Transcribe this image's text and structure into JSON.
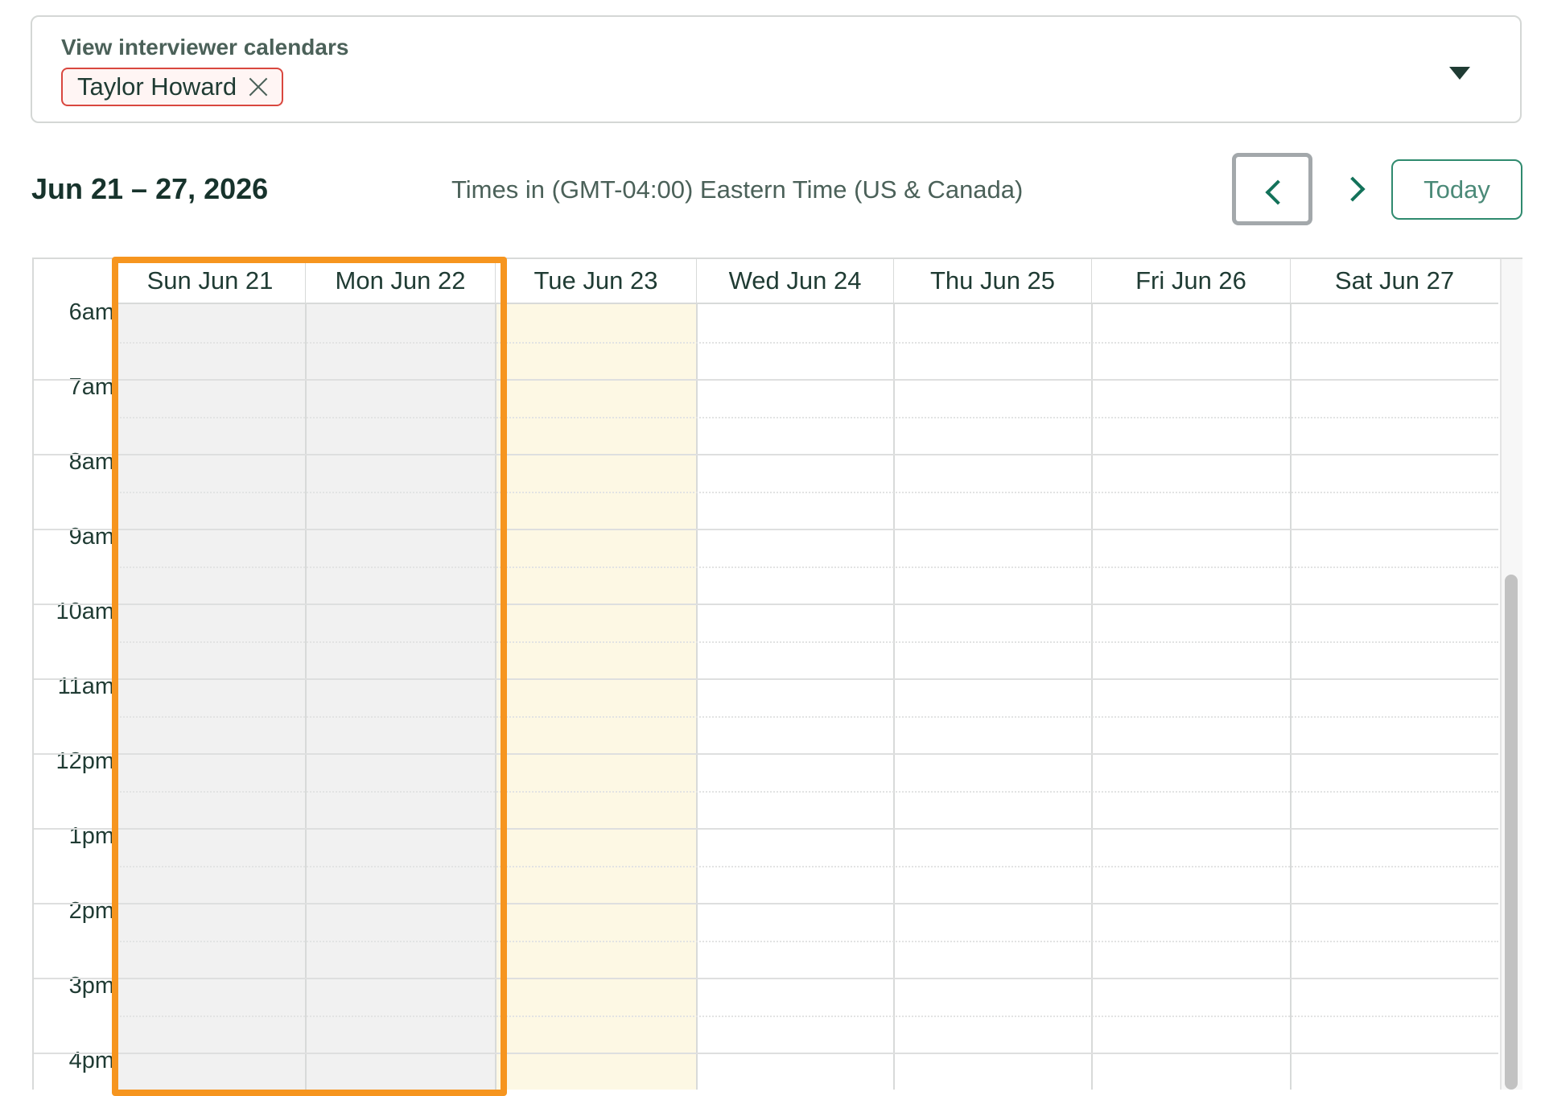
{
  "filter": {
    "label": "View interviewer calendars",
    "chip_label": "Taylor Howard",
    "chip_remove_icon": "close-icon",
    "dropdown_icon": "caret-down-icon"
  },
  "toolbar": {
    "range_title": "Jun 21 – 27, 2026",
    "timezone": "Times in (GMT-04:00) Eastern Time (US & Canada)",
    "prev_icon": "chevron-left-icon",
    "next_icon": "chevron-right-icon",
    "today_label": "Today"
  },
  "calendar": {
    "days": [
      {
        "label": "Sun Jun 21",
        "state": "weekend"
      },
      {
        "label": "Mon Jun 22",
        "state": "weekend"
      },
      {
        "label": "Tue Jun 23",
        "state": "today"
      },
      {
        "label": "Wed Jun 24",
        "state": "normal"
      },
      {
        "label": "Thu Jun 25",
        "state": "normal"
      },
      {
        "label": "Fri Jun 26",
        "state": "normal"
      },
      {
        "label": "Sat Jun 27",
        "state": "normal"
      }
    ],
    "hours": [
      "6am",
      "7am",
      "8am",
      "9am",
      "10am",
      "11am",
      "12pm",
      "1pm",
      "2pm",
      "3pm",
      "4pm"
    ]
  },
  "colors": {
    "highlight": "#f6951f",
    "accent": "#13725a",
    "chip_border": "#d9473f",
    "today_bg": "#fdf8e4",
    "unavailable_bg": "#f1f1f1"
  }
}
